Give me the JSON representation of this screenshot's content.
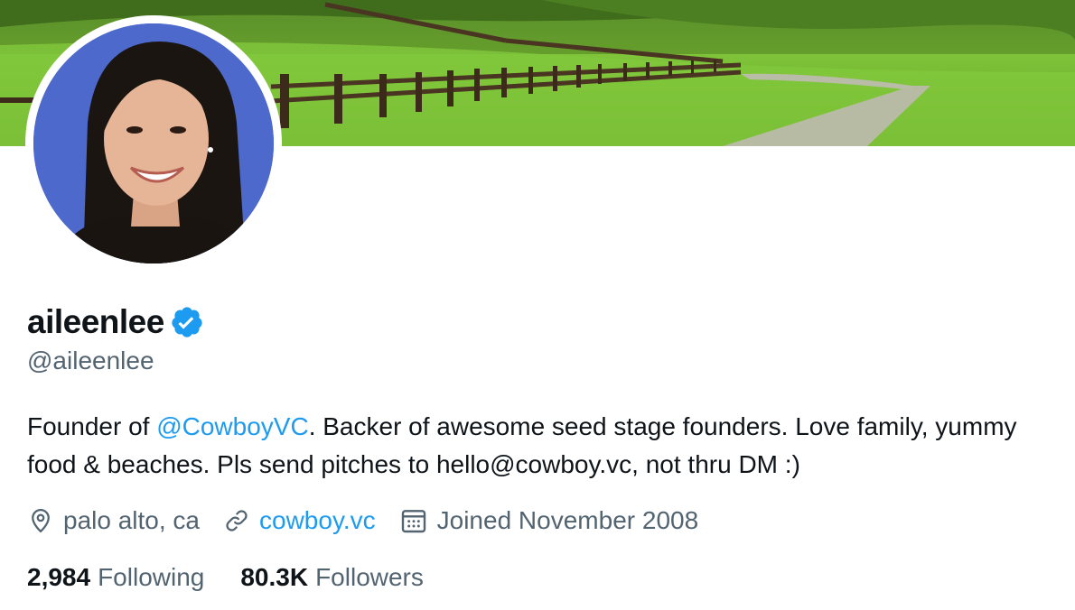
{
  "profile": {
    "display_name": "aileenlee",
    "handle": "@aileenlee",
    "verified_badge_icon": "verified-badge-icon",
    "bio_prefix": "Founder of ",
    "bio_mention": "@CowboyVC",
    "bio_suffix": ". Backer of awesome seed stage founders. Love family, yummy food & beaches. Pls send pitches to hello@cowboy.vc, not thru DM :)",
    "location": "palo alto, ca",
    "website": "cowboy.vc",
    "joined": "Joined November 2008",
    "following_count": "2,984",
    "following_label": "Following",
    "followers_count": "80.3K",
    "followers_label": "Followers"
  },
  "icons": {
    "location": "location-pin-icon",
    "link": "link-icon",
    "calendar": "calendar-icon"
  },
  "colors": {
    "accent": "#1d9bf0",
    "text_primary": "#0f1419",
    "text_secondary": "#536471"
  }
}
